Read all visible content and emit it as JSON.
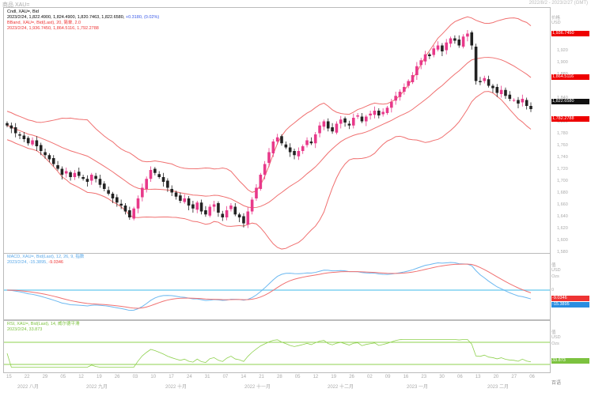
{
  "title": "商品 XAU=",
  "range": "2022/8/2 - 2023/2/27 (GMT)",
  "legend": {
    "cndl_name": "Cndl, XAU=, Bid",
    "cndl_values": "2023/2/24, 1,822.4900, 1,824.4900, 1,820.7463, 1,822.6580,",
    "cndl_change": "+0.3180, (0.02%)",
    "bb_name": "BBand, XAU=, Bid(Last), 20, 简单, 2.0",
    "bb_values": "2023/2/24, 1,936.7450, 1,864.5116, 1,792.2788",
    "macd_name": "MACD, XAU=, Bid(Last), 12, 26, 9, 指数",
    "macd_date": "2023/2/24, -15.3895,",
    "macd_signal": "-9.0346",
    "rsi_name": "RSI, XAU=, Bid(Last), 14, 威尔德平滑",
    "rsi_values": "2023/2/24, 33.873"
  },
  "axis": {
    "price_header": "价格",
    "currency": "USD",
    "price_ticks": [
      "1,920",
      "1,900",
      "1,880",
      "1,840",
      "1,800",
      "1,780",
      "1,760",
      "1,740",
      "1,720",
      "1,700",
      "1,680",
      "1,660",
      "1,640",
      "1,620",
      "1,600",
      "1,580"
    ],
    "bb_upper_tag": "1,936.7450",
    "bb_mid_tag": "1,864.5116",
    "last_tag": "1,822.6580",
    "bb_lower_tag": "1,782.2788",
    "macd_header": "值",
    "macd_unit": "USD",
    "macd_unit2": "Ozs",
    "macd_zero": "0",
    "macd_signal_tag": "-9.0346",
    "macd_tag": "-15.3895",
    "rsi_header": "值",
    "rsi_unit": "USD",
    "rsi_unit2": "Ozs",
    "rsi_tag": "33.873",
    "footer": "百语"
  },
  "dates": {
    "days": [
      "15",
      "22",
      "29",
      "05",
      "12",
      "19",
      "26",
      "03",
      "10",
      "17",
      "24",
      "31",
      "07",
      "14",
      "21",
      "28",
      "05",
      "12",
      "19",
      "26",
      "02",
      "09",
      "16",
      "23",
      "30",
      "06",
      "13",
      "20",
      "27",
      "06"
    ],
    "months": [
      "2022 八月",
      "2022 九月",
      "2022 十月",
      "2022 十一月",
      "2022 十二月",
      "2023 一月",
      "2023 二月"
    ]
  },
  "colors": {
    "up": "#e8398a",
    "down": "#222222",
    "band": "#f07070",
    "macd": "#6cb8f0",
    "signal": "#f07070",
    "rsi": "#8fd14f",
    "zero": "#7fd0f0"
  },
  "chart_data": {
    "type": "candlestick",
    "ylim": [
      1570,
      1960
    ],
    "closes": [
      1795,
      1790,
      1782,
      1778,
      1772,
      1765,
      1770,
      1760,
      1752,
      1745,
      1738,
      1730,
      1722,
      1712,
      1718,
      1708,
      1715,
      1710,
      1705,
      1700,
      1712,
      1705,
      1695,
      1688,
      1680,
      1672,
      1665,
      1660,
      1650,
      1640,
      1655,
      1672,
      1690,
      1705,
      1720,
      1715,
      1708,
      1700,
      1690,
      1682,
      1675,
      1668,
      1672,
      1660,
      1655,
      1665,
      1650,
      1645,
      1658,
      1662,
      1648,
      1640,
      1652,
      1660,
      1645,
      1640,
      1630,
      1650,
      1670,
      1690,
      1712,
      1730,
      1750,
      1768,
      1775,
      1765,
      1758,
      1750,
      1745,
      1752,
      1760,
      1770,
      1765,
      1780,
      1795,
      1802,
      1790,
      1785,
      1798,
      1805,
      1800,
      1795,
      1808,
      1812,
      1802,
      1810,
      1815,
      1820,
      1812,
      1818,
      1825,
      1835,
      1845,
      1852,
      1860,
      1870,
      1880,
      1895,
      1905,
      1915,
      1912,
      1925,
      1930,
      1920,
      1935,
      1942,
      1938,
      1930,
      1945,
      1950,
      1930,
      1870,
      1868,
      1875,
      1862,
      1858,
      1850,
      1855,
      1845,
      1840,
      1838,
      1832,
      1840,
      1828,
      1822.66
    ]
  }
}
